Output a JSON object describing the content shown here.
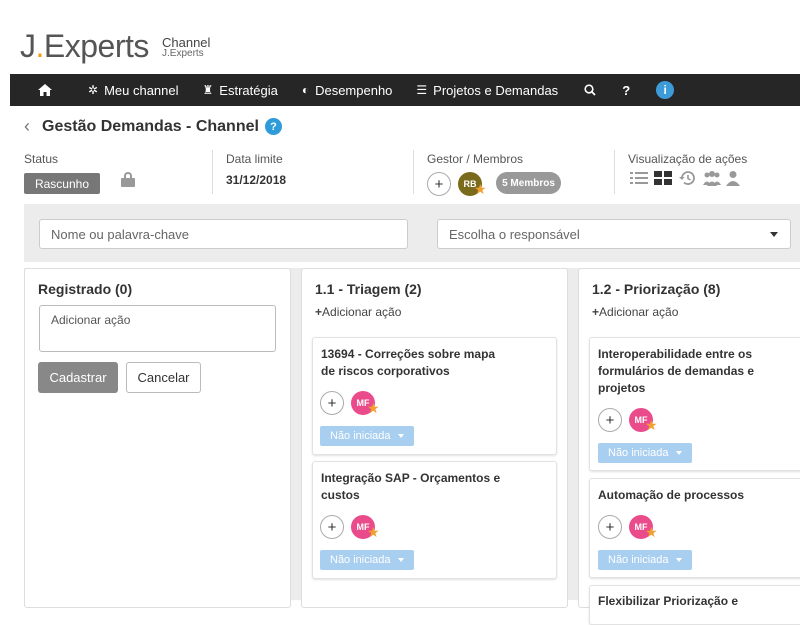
{
  "brand": {
    "logo": "J.Experts",
    "sub1": "Channel",
    "sub2": "J.Experts"
  },
  "nav": {
    "items": [
      {
        "label": "Meu channel",
        "icon": "gear-icon"
      },
      {
        "label": "Estratégia",
        "icon": "chess-rook-icon"
      },
      {
        "label": "Desempenho",
        "icon": "pie-chart-icon"
      },
      {
        "label": "Projetos e Demandas",
        "icon": "list-icon"
      }
    ],
    "help": "?",
    "info": "i"
  },
  "page": {
    "title": "Gestão Demandas - Channel",
    "help": "?"
  },
  "meta": {
    "status_label": "Status",
    "status_value": "Rascunho",
    "date_label": "Data limite",
    "date_value": "31/12/2018",
    "gestor_label": "Gestor / Membros",
    "gestor_initials": "RB",
    "members_label": "5 Membros",
    "viz_label": "Visualização de ações"
  },
  "filters": {
    "search_placeholder": "Nome ou palavra-chave",
    "responsavel_placeholder": "Escolha o responsável"
  },
  "columns": [
    {
      "title": "Registrado (0)",
      "textarea_placeholder": "Adicionar ação",
      "submit_label": "Cadastrar",
      "cancel_label": "Cancelar"
    },
    {
      "title": "1.1 - Triagem (2)",
      "add_label": "Adicionar ação",
      "cards": [
        {
          "line1": "13694 - Correções sobre mapa",
          "line2": "de riscos corporativos",
          "avatar": "MF",
          "status": "Não iniciada"
        },
        {
          "line1": "Integração SAP - Orçamentos e",
          "line2": "custos",
          "avatar": "MF",
          "status": "Não iniciada"
        }
      ]
    },
    {
      "title": "1.2 - Priorização (8)",
      "add_label": "Adicionar ação",
      "cards": [
        {
          "line1": "Interoperabilidade entre os",
          "line2": "formulários de demandas e",
          "line3": "projetos",
          "avatar": "MF",
          "status": "Não iniciada"
        },
        {
          "line1": "Automação de processos",
          "avatar": "MF",
          "status": "Não iniciada"
        },
        {
          "line1": "Flexibilizar Priorização e"
        }
      ]
    }
  ],
  "colors": {
    "navbar": "#262626",
    "status_pill": "#a8cef0",
    "avatar_mf": "#ea4b8a",
    "avatar_rb": "#7a6a1c",
    "accent": "#2d9cd8",
    "star": "#f0a030"
  }
}
